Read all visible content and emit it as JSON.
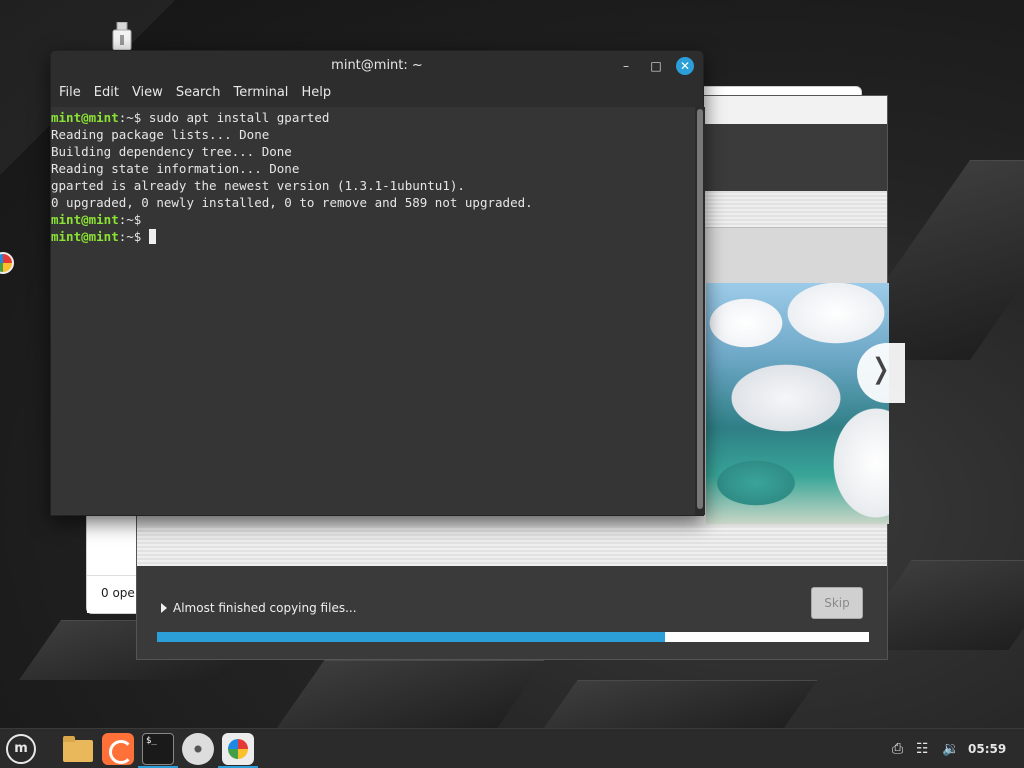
{
  "terminal": {
    "title": "mint@mint: ~",
    "menu": [
      "File",
      "Edit",
      "View",
      "Search",
      "Terminal",
      "Help"
    ],
    "prompt_user": "mint@mint",
    "prompt_path": ":~$",
    "lines": [
      {
        "type": "prompt",
        "command": " sudo apt install gparted"
      },
      {
        "type": "output",
        "text": "Reading package lists... Done"
      },
      {
        "type": "output",
        "text": "Building dependency tree... Done"
      },
      {
        "type": "output",
        "text": "Reading state information... Done"
      },
      {
        "type": "output",
        "text": "gparted is already the newest version (1.3.1-1ubuntu1)."
      },
      {
        "type": "output",
        "text": "0 upgraded, 0 newly installed, 0 to remove and 589 not upgraded."
      },
      {
        "type": "prompt",
        "command": ""
      },
      {
        "type": "prompt",
        "command": " ",
        "cursor": true
      }
    ]
  },
  "installer": {
    "progress_label": "Almost finished copying files...",
    "skip_label": "Skip",
    "progress_fraction": 0.713,
    "next_glyph": "❭"
  },
  "background_window": {
    "status_text": "0 ope"
  },
  "taskbar": {
    "menu_glyph": "m",
    "terminal_glyph": "$_",
    "clock": "05:59",
    "accent": "#2c9fd9"
  },
  "icons": {
    "window_minimize": "–",
    "window_maximize": "□",
    "window_close": "✕",
    "tray_notes": "⎙",
    "tray_network": "☷",
    "tray_volume": "🔉"
  }
}
